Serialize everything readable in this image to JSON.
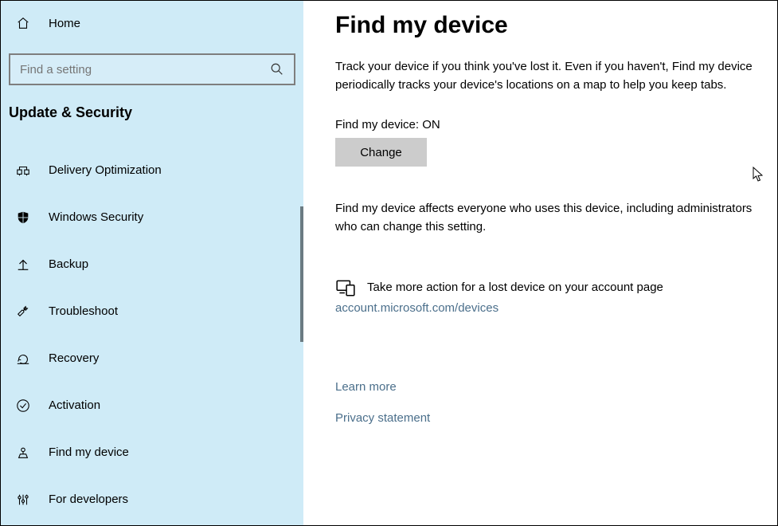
{
  "sidebar": {
    "home_label": "Home",
    "search_placeholder": "Find a setting",
    "category": "Update & Security",
    "items": [
      {
        "label": "Delivery Optimization"
      },
      {
        "label": "Windows Security"
      },
      {
        "label": "Backup"
      },
      {
        "label": "Troubleshoot"
      },
      {
        "label": "Recovery"
      },
      {
        "label": "Activation"
      },
      {
        "label": "Find my device"
      },
      {
        "label": "For developers"
      }
    ]
  },
  "main": {
    "title": "Find my device",
    "description": "Track your device if you think you've lost it. Even if you haven't, Find my device periodically tracks your device's locations on a map to help you keep tabs.",
    "status_line": "Find my device: ON",
    "change_label": "Change",
    "note": "Find my device affects everyone who uses this device, including administrators who can change this setting.",
    "action_text": "Take more action for a lost device on your account page",
    "action_link": "account.microsoft.com/devices",
    "learn_more": "Learn more",
    "privacy": "Privacy statement"
  }
}
